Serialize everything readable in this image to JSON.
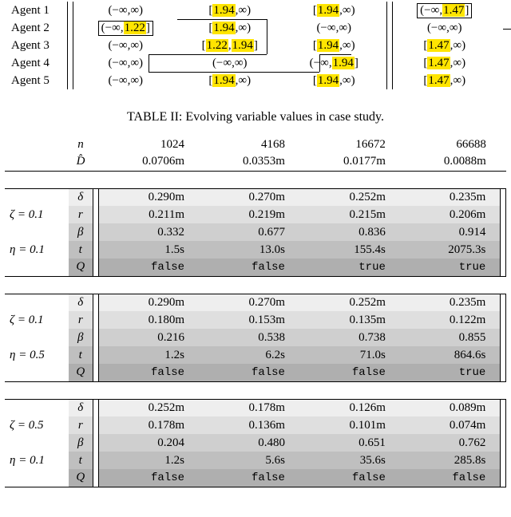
{
  "top_table": {
    "agents": [
      {
        "name": "Agent 1",
        "c1": {
          "a": "(−∞,",
          "b": "∞)"
        },
        "c2": {
          "a": "[",
          "hl": "1.94",
          "b": ",∞)"
        },
        "c3": {
          "a": "[",
          "hl": "1.94",
          "b": ",∞)"
        },
        "c4": {
          "a": "(−∞,",
          "hl": "1.47",
          "b": "]",
          "box": true
        }
      },
      {
        "name": "Agent 2",
        "c1": {
          "a": "(−∞,",
          "hl": "1.22",
          "b": "]",
          "box": true
        },
        "c2": {
          "a": "[",
          "hl": "1.94",
          "b": ",∞)"
        },
        "c3": {
          "a": "(−∞,",
          "b": "∞)"
        },
        "c4": {
          "a": "(−∞,",
          "b": "∞)"
        }
      },
      {
        "name": "Agent 3",
        "c1": {
          "a": "(−∞,",
          "b": "∞)"
        },
        "c2": {
          "a": "[",
          "hl": "1.22",
          "b": ",",
          "hl2": "1.94",
          "b2": "]"
        },
        "c3": {
          "a": "[",
          "hl": "1.94",
          "b": ",∞)"
        },
        "c4": {
          "a": "[",
          "hl": "1.47",
          "b": ",∞)"
        }
      },
      {
        "name": "Agent 4",
        "c1": {
          "a": "(−∞,",
          "b": "∞)"
        },
        "c2": {
          "a": "(−∞,",
          "b": "∞)"
        },
        "c3": {
          "a": "(−∞,",
          "hl": "1.94",
          "b": "]"
        },
        "c4": {
          "a": "[",
          "hl": "1.47",
          "b": ",∞)"
        }
      },
      {
        "name": "Agent 5",
        "c1": {
          "a": "(−∞,",
          "b": "∞)"
        },
        "c2": {
          "a": "[",
          "hl": "1.94",
          "b": ",∞)"
        },
        "c3": {
          "a": "[",
          "hl": "1.94",
          "b": ",∞)"
        },
        "c4": {
          "a": "[",
          "hl": "1.47",
          "b": ",∞)"
        }
      }
    ]
  },
  "caption": "TABLE II:   Evolving variable values in case study.",
  "header": {
    "n_sym": "n",
    "n": [
      "1024",
      "4168",
      "16672",
      "66688"
    ],
    "d_sym": "D̂",
    "d": [
      "0.0706m",
      "0.0353m",
      "0.0177m",
      "0.0088m"
    ]
  },
  "groups": [
    {
      "zeta": "ζ = 0.1",
      "eta": "η = 0.1",
      "rows": [
        {
          "sym": "δ",
          "v": [
            "0.290m",
            "0.270m",
            "0.252m",
            "0.235m"
          ]
        },
        {
          "sym": "r",
          "v": [
            "0.211m",
            "0.219m",
            "0.215m",
            "0.206m"
          ]
        },
        {
          "sym": "β",
          "v": [
            "0.332",
            "0.677",
            "0.836",
            "0.914"
          ]
        },
        {
          "sym": "t",
          "v": [
            "1.5s",
            "13.0s",
            "155.4s",
            "2075.3s"
          ]
        },
        {
          "sym": "Q",
          "mono": true,
          "v": [
            "false",
            "false",
            "true",
            "true"
          ]
        }
      ]
    },
    {
      "zeta": "ζ = 0.1",
      "eta": "η = 0.5",
      "rows": [
        {
          "sym": "δ",
          "v": [
            "0.290m",
            "0.270m",
            "0.252m",
            "0.235m"
          ]
        },
        {
          "sym": "r",
          "v": [
            "0.180m",
            "0.153m",
            "0.135m",
            "0.122m"
          ]
        },
        {
          "sym": "β",
          "v": [
            "0.216",
            "0.538",
            "0.738",
            "0.855"
          ]
        },
        {
          "sym": "t",
          "v": [
            "1.2s",
            "6.2s",
            "71.0s",
            "864.6s"
          ]
        },
        {
          "sym": "Q",
          "mono": true,
          "v": [
            "false",
            "false",
            "false",
            "true"
          ]
        }
      ]
    },
    {
      "zeta": "ζ = 0.5",
      "eta": "η = 0.1",
      "rows": [
        {
          "sym": "δ",
          "v": [
            "0.252m",
            "0.178m",
            "0.126m",
            "0.089m"
          ]
        },
        {
          "sym": "r",
          "v": [
            "0.178m",
            "0.136m",
            "0.101m",
            "0.074m"
          ]
        },
        {
          "sym": "β",
          "v": [
            "0.204",
            "0.480",
            "0.651",
            "0.762"
          ]
        },
        {
          "sym": "t",
          "v": [
            "1.2s",
            "5.6s",
            "35.6s",
            "285.8s"
          ]
        },
        {
          "sym": "Q",
          "mono": true,
          "v": [
            "false",
            "false",
            "false",
            "false"
          ]
        }
      ]
    }
  ]
}
